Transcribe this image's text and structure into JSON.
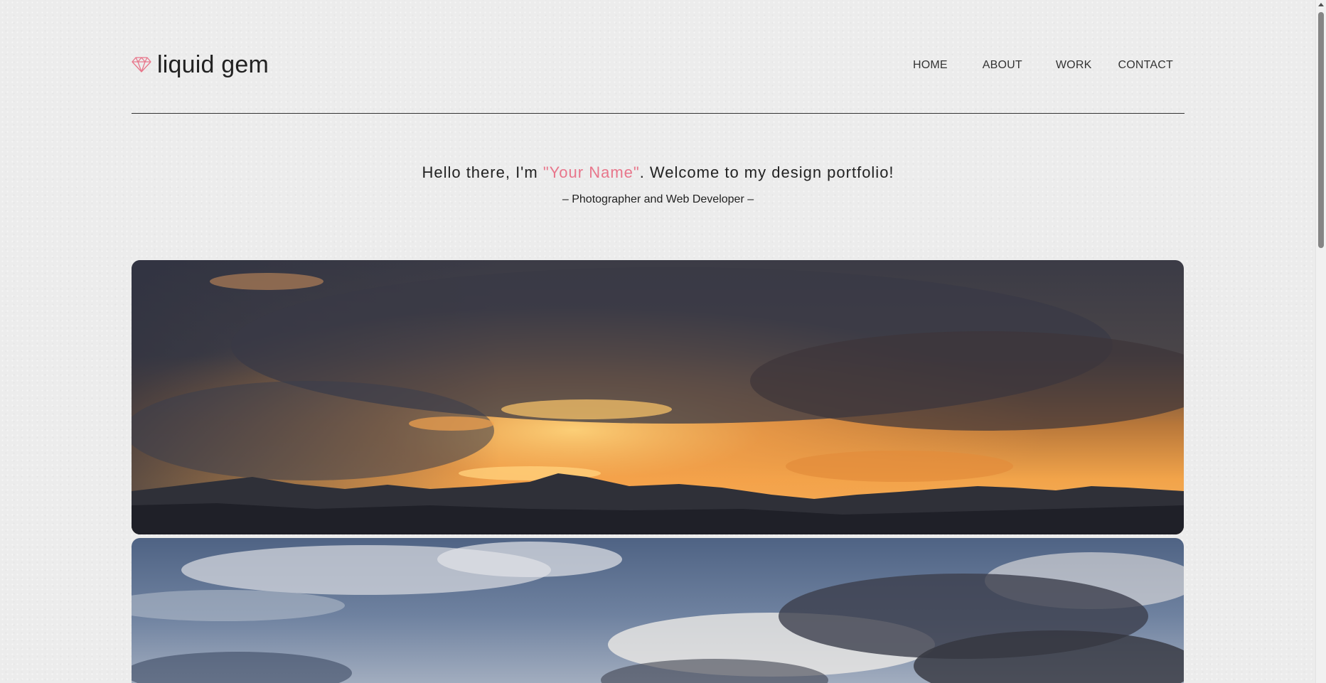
{
  "site": {
    "logo_text": "liquid gem",
    "logo_icon": "gem-icon",
    "accent_color": "#e8768b"
  },
  "nav": {
    "items": [
      {
        "label": "HOME"
      },
      {
        "label": "ABOUT"
      },
      {
        "label": "WORK"
      },
      {
        "label": "CONTACT"
      }
    ]
  },
  "intro": {
    "greeting_prefix": "Hello there, I'm ",
    "name": "\"Your Name\"",
    "greeting_suffix": ". Welcome to my design portfolio!",
    "subtitle": "– Photographer and Web Developer –"
  },
  "gallery": {
    "images": [
      {
        "subject": "sunset over mountains"
      },
      {
        "subject": "cloudy sky"
      }
    ]
  }
}
